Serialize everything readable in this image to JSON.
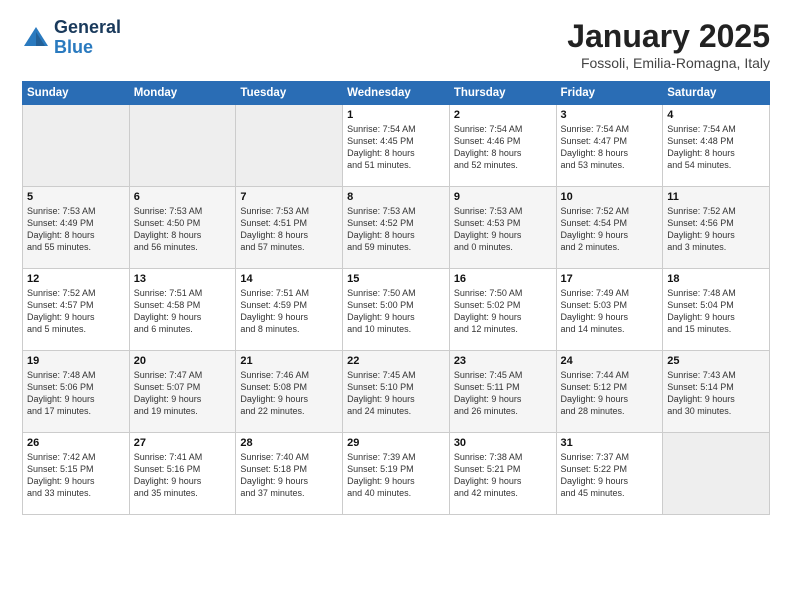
{
  "header": {
    "logo_general": "General",
    "logo_blue": "Blue",
    "title": "January 2025",
    "subtitle": "Fossoli, Emilia-Romagna, Italy"
  },
  "days_of_week": [
    "Sunday",
    "Monday",
    "Tuesday",
    "Wednesday",
    "Thursday",
    "Friday",
    "Saturday"
  ],
  "weeks": [
    [
      {
        "day": "",
        "info": ""
      },
      {
        "day": "",
        "info": ""
      },
      {
        "day": "",
        "info": ""
      },
      {
        "day": "1",
        "info": "Sunrise: 7:54 AM\nSunset: 4:45 PM\nDaylight: 8 hours\nand 51 minutes."
      },
      {
        "day": "2",
        "info": "Sunrise: 7:54 AM\nSunset: 4:46 PM\nDaylight: 8 hours\nand 52 minutes."
      },
      {
        "day": "3",
        "info": "Sunrise: 7:54 AM\nSunset: 4:47 PM\nDaylight: 8 hours\nand 53 minutes."
      },
      {
        "day": "4",
        "info": "Sunrise: 7:54 AM\nSunset: 4:48 PM\nDaylight: 8 hours\nand 54 minutes."
      }
    ],
    [
      {
        "day": "5",
        "info": "Sunrise: 7:53 AM\nSunset: 4:49 PM\nDaylight: 8 hours\nand 55 minutes."
      },
      {
        "day": "6",
        "info": "Sunrise: 7:53 AM\nSunset: 4:50 PM\nDaylight: 8 hours\nand 56 minutes."
      },
      {
        "day": "7",
        "info": "Sunrise: 7:53 AM\nSunset: 4:51 PM\nDaylight: 8 hours\nand 57 minutes."
      },
      {
        "day": "8",
        "info": "Sunrise: 7:53 AM\nSunset: 4:52 PM\nDaylight: 8 hours\nand 59 minutes."
      },
      {
        "day": "9",
        "info": "Sunrise: 7:53 AM\nSunset: 4:53 PM\nDaylight: 9 hours\nand 0 minutes."
      },
      {
        "day": "10",
        "info": "Sunrise: 7:52 AM\nSunset: 4:54 PM\nDaylight: 9 hours\nand 2 minutes."
      },
      {
        "day": "11",
        "info": "Sunrise: 7:52 AM\nSunset: 4:56 PM\nDaylight: 9 hours\nand 3 minutes."
      }
    ],
    [
      {
        "day": "12",
        "info": "Sunrise: 7:52 AM\nSunset: 4:57 PM\nDaylight: 9 hours\nand 5 minutes."
      },
      {
        "day": "13",
        "info": "Sunrise: 7:51 AM\nSunset: 4:58 PM\nDaylight: 9 hours\nand 6 minutes."
      },
      {
        "day": "14",
        "info": "Sunrise: 7:51 AM\nSunset: 4:59 PM\nDaylight: 9 hours\nand 8 minutes."
      },
      {
        "day": "15",
        "info": "Sunrise: 7:50 AM\nSunset: 5:00 PM\nDaylight: 9 hours\nand 10 minutes."
      },
      {
        "day": "16",
        "info": "Sunrise: 7:50 AM\nSunset: 5:02 PM\nDaylight: 9 hours\nand 12 minutes."
      },
      {
        "day": "17",
        "info": "Sunrise: 7:49 AM\nSunset: 5:03 PM\nDaylight: 9 hours\nand 14 minutes."
      },
      {
        "day": "18",
        "info": "Sunrise: 7:48 AM\nSunset: 5:04 PM\nDaylight: 9 hours\nand 15 minutes."
      }
    ],
    [
      {
        "day": "19",
        "info": "Sunrise: 7:48 AM\nSunset: 5:06 PM\nDaylight: 9 hours\nand 17 minutes."
      },
      {
        "day": "20",
        "info": "Sunrise: 7:47 AM\nSunset: 5:07 PM\nDaylight: 9 hours\nand 19 minutes."
      },
      {
        "day": "21",
        "info": "Sunrise: 7:46 AM\nSunset: 5:08 PM\nDaylight: 9 hours\nand 22 minutes."
      },
      {
        "day": "22",
        "info": "Sunrise: 7:45 AM\nSunset: 5:10 PM\nDaylight: 9 hours\nand 24 minutes."
      },
      {
        "day": "23",
        "info": "Sunrise: 7:45 AM\nSunset: 5:11 PM\nDaylight: 9 hours\nand 26 minutes."
      },
      {
        "day": "24",
        "info": "Sunrise: 7:44 AM\nSunset: 5:12 PM\nDaylight: 9 hours\nand 28 minutes."
      },
      {
        "day": "25",
        "info": "Sunrise: 7:43 AM\nSunset: 5:14 PM\nDaylight: 9 hours\nand 30 minutes."
      }
    ],
    [
      {
        "day": "26",
        "info": "Sunrise: 7:42 AM\nSunset: 5:15 PM\nDaylight: 9 hours\nand 33 minutes."
      },
      {
        "day": "27",
        "info": "Sunrise: 7:41 AM\nSunset: 5:16 PM\nDaylight: 9 hours\nand 35 minutes."
      },
      {
        "day": "28",
        "info": "Sunrise: 7:40 AM\nSunset: 5:18 PM\nDaylight: 9 hours\nand 37 minutes."
      },
      {
        "day": "29",
        "info": "Sunrise: 7:39 AM\nSunset: 5:19 PM\nDaylight: 9 hours\nand 40 minutes."
      },
      {
        "day": "30",
        "info": "Sunrise: 7:38 AM\nSunset: 5:21 PM\nDaylight: 9 hours\nand 42 minutes."
      },
      {
        "day": "31",
        "info": "Sunrise: 7:37 AM\nSunset: 5:22 PM\nDaylight: 9 hours\nand 45 minutes."
      },
      {
        "day": "",
        "info": ""
      }
    ]
  ]
}
